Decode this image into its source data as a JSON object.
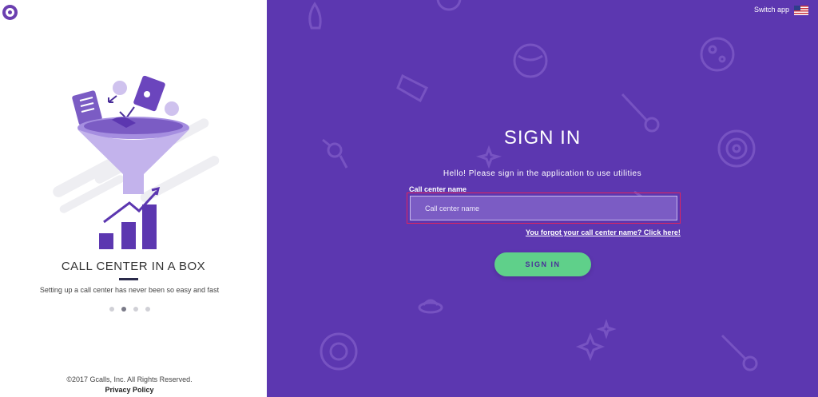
{
  "left": {
    "logo_icon": "disc-logo-icon",
    "slide_title": "CALL CENTER IN A BOX",
    "slide_subtitle": "Setting up a call center has never been so easy and fast",
    "dots": {
      "count": 4,
      "active_index": 1
    },
    "copyright": "©2017 Gcalls, Inc. All Rights Reserved.",
    "privacy_link": "Privacy Policy"
  },
  "header": {
    "switch_app": "Switch app",
    "flag_icon": "us-flag-icon"
  },
  "signin": {
    "title": "SIGN IN",
    "hello": "Hello! Please sign in the application to use utilities",
    "field_label": "Call center name",
    "field_placeholder": "Call center name",
    "field_value": "",
    "forgot_link": "You forgot your call center name? Click here!",
    "button_label": "SIGN IN"
  },
  "colors": {
    "primary_purple": "#5c37b0",
    "button_green": "#5fd08a",
    "highlight_red": "#e0245e"
  }
}
